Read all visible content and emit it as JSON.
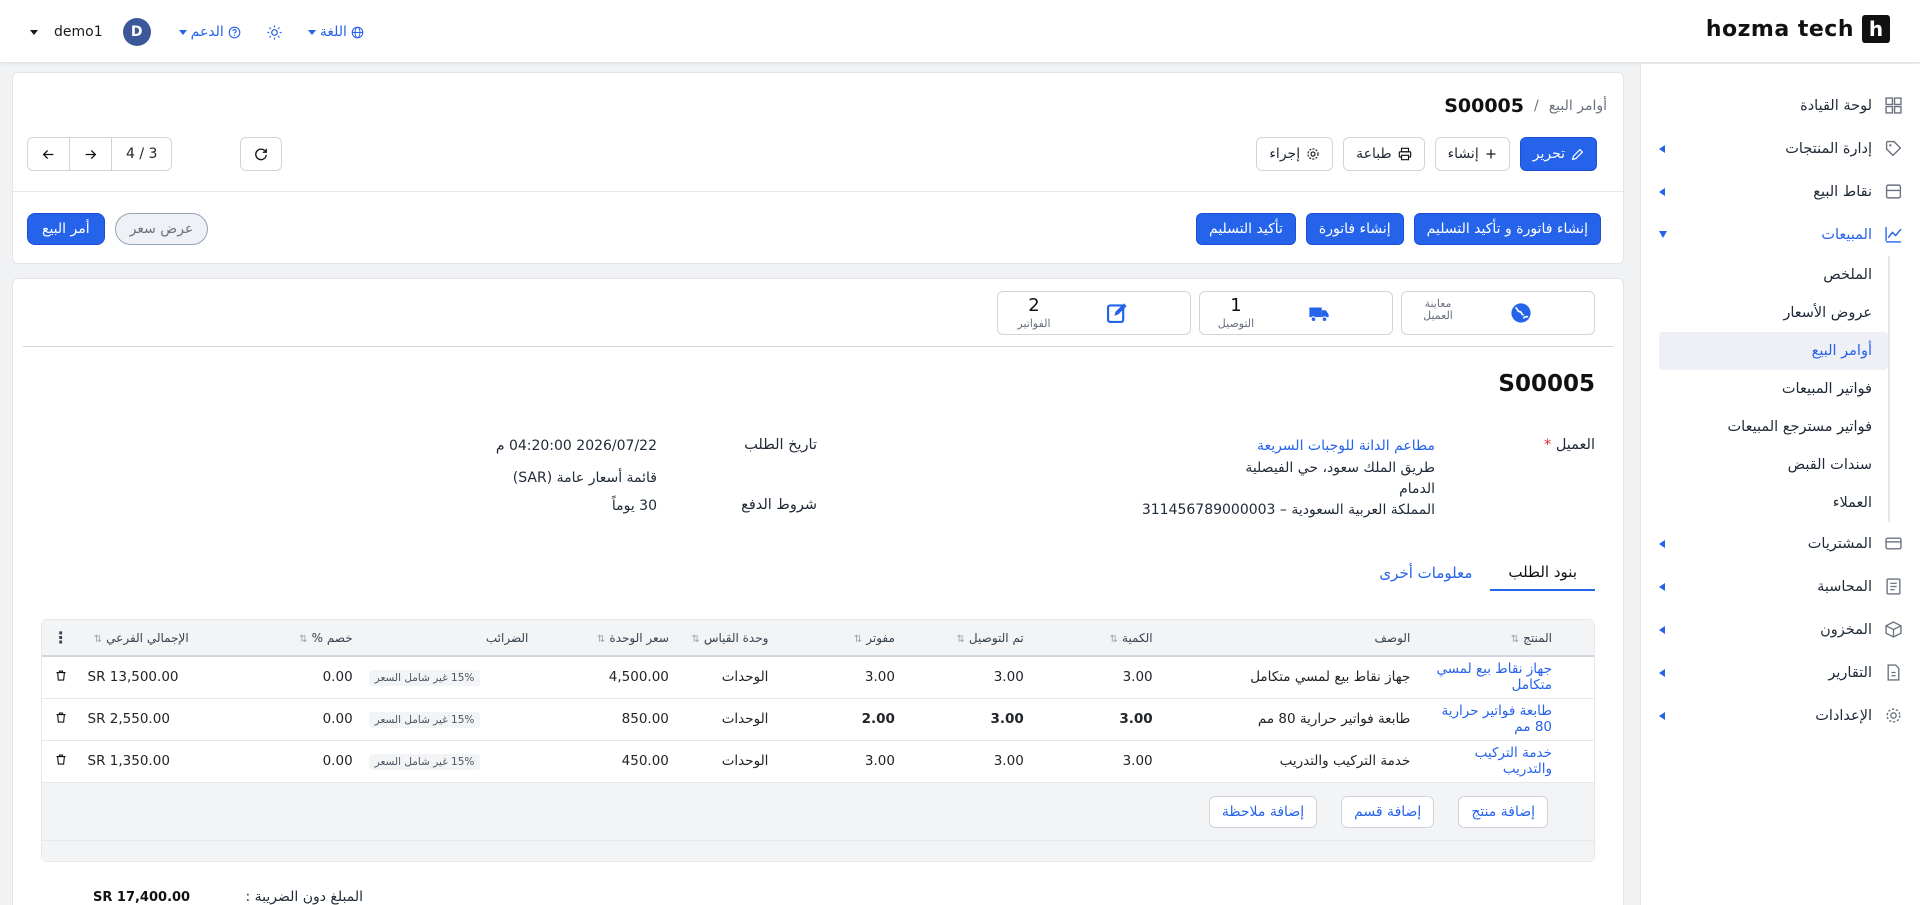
{
  "topbar": {
    "brand": "hozma tech",
    "brand_mark": "h",
    "user": "demo1",
    "avatar_letter": "D",
    "support": "الدعم",
    "language": "اللغة"
  },
  "sidebar": {
    "items": [
      {
        "label": "لوحة القيادة",
        "icon": "dashboard-icon"
      },
      {
        "label": "إدارة المنتجات",
        "icon": "tag-icon"
      },
      {
        "label": "نقاط البيع",
        "icon": "store-icon"
      },
      {
        "label": "المبيعات",
        "icon": "chart-icon"
      },
      {
        "label": "المشتريات",
        "icon": "card-icon"
      },
      {
        "label": "المحاسبة",
        "icon": "ledger-icon"
      },
      {
        "label": "المخزون",
        "icon": "box-icon"
      },
      {
        "label": "التقارير",
        "icon": "report-icon"
      },
      {
        "label": "الإعدادات",
        "icon": "gear-icon"
      }
    ],
    "sales_sub": [
      "الملخص",
      "عروض الأسعار",
      "أوامر البيع",
      "فواتير المبيعات",
      "فواتير مسترجع المبيعات",
      "سندات القبض",
      "العملاء"
    ]
  },
  "header": {
    "breadcrumb_parent": "أوامر البيع",
    "breadcrumb_sep": "/",
    "breadcrumb_current": "S00005",
    "edit": "تحرير",
    "create": "إنشاء",
    "print": "طباعة",
    "action": "إجراء",
    "pager_count": "3 / 4",
    "btn_invoice_deliver": "إنشاء فاتورة و تأكيد التسليم",
    "btn_invoice": "إنشاء فاتورة",
    "btn_deliver": "تأكيد التسليم",
    "state_quote": "عرض سعر",
    "state_order": "أمر البيع"
  },
  "stats": {
    "preview_label_1": "معاينة",
    "preview_label_2": "العميل",
    "delivery_count": "1",
    "delivery_label": "التوصيل",
    "invoices_count": "2",
    "invoices_label": "الفواتير"
  },
  "order": {
    "title": "S00005",
    "customer_label": "العميل",
    "customer_name": "مطاعم الدانة للوجبات السريعة",
    "addr1": "طريق الملك سعود، حي الفيصلية",
    "addr2": "الدمام",
    "addr3": "المملكة العربية السعودية – 311456789000003",
    "date_label": "تاريخ الطلب",
    "date_value": "2026/07/22 04:20:00 م",
    "pricelist": "قائمة أسعار عامة (SAR)",
    "terms_label": "شروط الدفع",
    "terms_value": "30 يوماً"
  },
  "tabs": {
    "lines": "بنود الطلب",
    "other": "معلومات أخرى"
  },
  "table": {
    "headers": [
      "المنتج",
      "الوصف",
      "الكمية",
      "تم التوصيل",
      "مفوتر",
      "وحدة القياس",
      "سعر الوحدة",
      "الضرائب",
      "خصم %",
      "الإجمالي الفرعي"
    ],
    "rows": [
      {
        "product": "جهاز نقاط بيع لمسي متكامل",
        "desc": "جهاز نقاط بيع لمسي متكامل",
        "qty": "3.00",
        "delivered": "3.00",
        "invoiced": "3.00",
        "uom": "الوحدات",
        "price": "4,500.00",
        "tax": "15% غير شامل السعر",
        "disc": "0.00",
        "subtotal": "SR 13,500.00"
      },
      {
        "product": "طابعة فواتير حرارية 80 مم",
        "desc": "طابعة فواتير حرارية 80 مم",
        "qty": "3.00",
        "delivered": "3.00",
        "invoiced": "2.00",
        "uom": "الوحدات",
        "price": "850.00",
        "tax": "15% غير شامل السعر",
        "disc": "0.00",
        "subtotal": "SR 2,550.00"
      },
      {
        "product": "خدمة التركيب والتدريب",
        "desc": "خدمة التركيب والتدريب",
        "qty": "3.00",
        "delivered": "3.00",
        "invoiced": "3.00",
        "uom": "الوحدات",
        "price": "450.00",
        "tax": "15% غير شامل السعر",
        "disc": "0.00",
        "subtotal": "SR 1,350.00"
      }
    ],
    "add_product": "إضافة منتج",
    "add_section": "إضافة قسم",
    "add_note": "إضافة ملاحظة"
  },
  "totals": {
    "untaxed_label": "المبلغ دون الضريبة :",
    "untaxed_value": "SR 17,400.00"
  }
}
